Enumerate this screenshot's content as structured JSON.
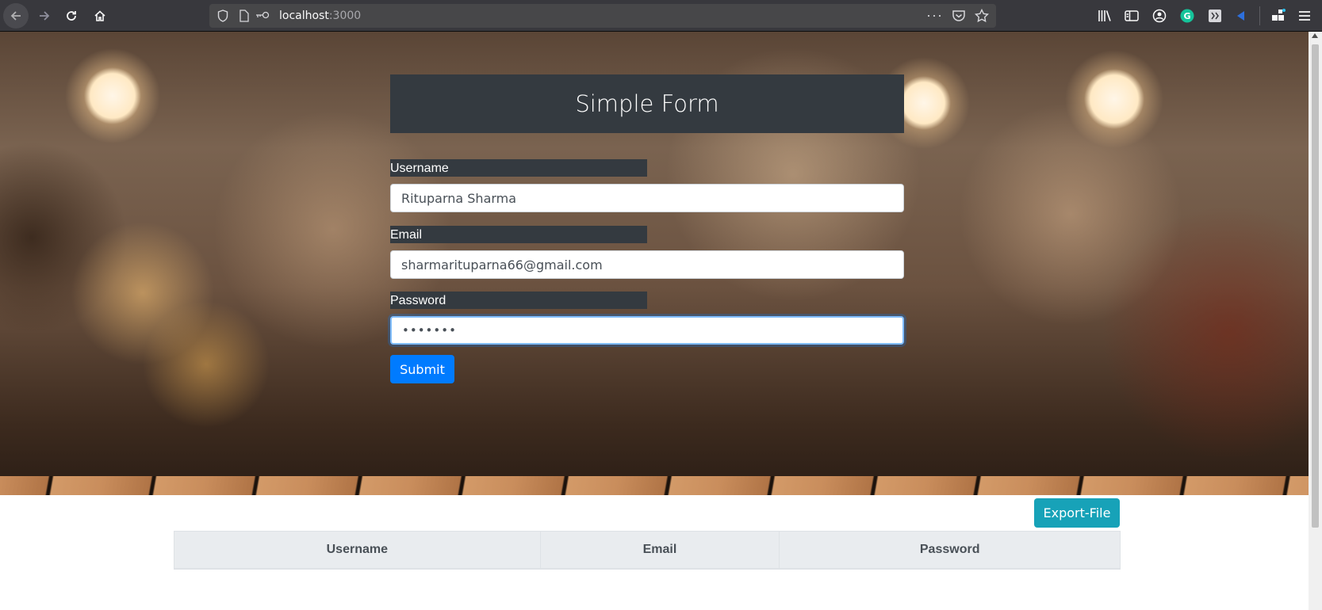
{
  "browser": {
    "url_host": "localhost",
    "url_port": ":3000",
    "icons": [
      "back-icon",
      "forward-icon",
      "reload-icon",
      "home-icon",
      "shield-icon",
      "page-icon",
      "key-icon",
      "more-icon",
      "pocket-icon",
      "star-icon",
      "library-icon",
      "sidebar-icon",
      "account-icon",
      "grammarly-icon",
      "extension-icon",
      "extension2-icon",
      "extensions-menu-icon",
      "hamburger-menu-icon"
    ]
  },
  "form": {
    "title": "Simple Form",
    "username_label": "Username",
    "username_value": "Rituparna Sharma",
    "email_label": "Email",
    "email_value": "sharmarituparna66@gmail.com",
    "password_label": "Password",
    "password_value": "•••••••",
    "submit_label": "Submit"
  },
  "table": {
    "export_label": "Export-File",
    "headers": [
      "Username",
      "Email",
      "Password"
    ]
  },
  "colors": {
    "header_bg": "#343a40",
    "primary": "#007bff",
    "info": "#17a2b8"
  }
}
